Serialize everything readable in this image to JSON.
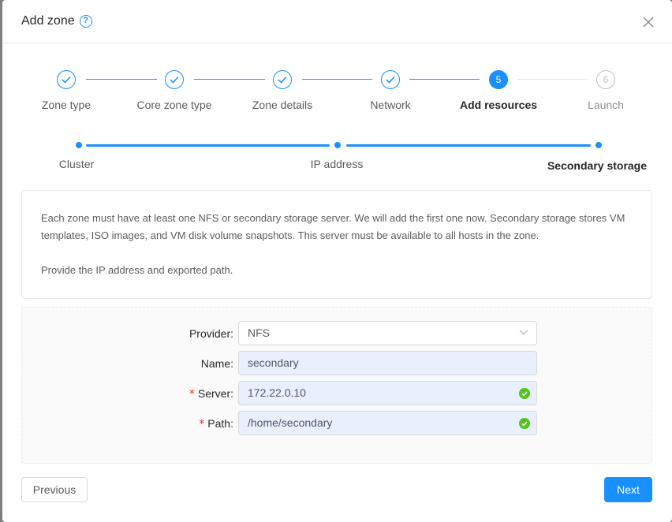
{
  "modal": {
    "title": "Add zone",
    "help_icon": "question-circle-icon",
    "close_icon": "close-icon"
  },
  "steps": [
    {
      "label": "Zone type",
      "status": "finish"
    },
    {
      "label": "Core zone type",
      "status": "finish"
    },
    {
      "label": "Zone details",
      "status": "finish"
    },
    {
      "label": "Network",
      "status": "finish"
    },
    {
      "label": "Add resources",
      "status": "process",
      "number": "5"
    },
    {
      "label": "Launch",
      "status": "wait",
      "number": "6"
    }
  ],
  "sub_steps": [
    {
      "label": "Cluster",
      "status": "finish"
    },
    {
      "label": "IP address",
      "status": "finish"
    },
    {
      "label": "Secondary storage",
      "status": "process"
    }
  ],
  "description": {
    "para1": "Each zone must have at least one NFS or secondary storage server. We will add the first one now. Secondary storage stores VM templates, ISO images, and VM disk volume snapshots. This server must be available to all hosts in the zone.",
    "para2": "Provide the IP address and exported path."
  },
  "form": {
    "provider": {
      "label": "Provider:",
      "value": "NFS",
      "required": false
    },
    "name": {
      "label": "Name:",
      "value": "secondary",
      "required": false
    },
    "server": {
      "label": "Server:",
      "value": "172.22.0.10",
      "required": true,
      "required_mark": "*"
    },
    "path": {
      "label": "Path:",
      "value": "/home/secondary",
      "required": true,
      "required_mark": "*"
    }
  },
  "buttons": {
    "previous": "Previous",
    "next": "Next"
  },
  "colors": {
    "primary": "#1890ff",
    "success": "#52c41a",
    "required": "#f5222d",
    "autofill_bg": "#e8f0fe"
  }
}
